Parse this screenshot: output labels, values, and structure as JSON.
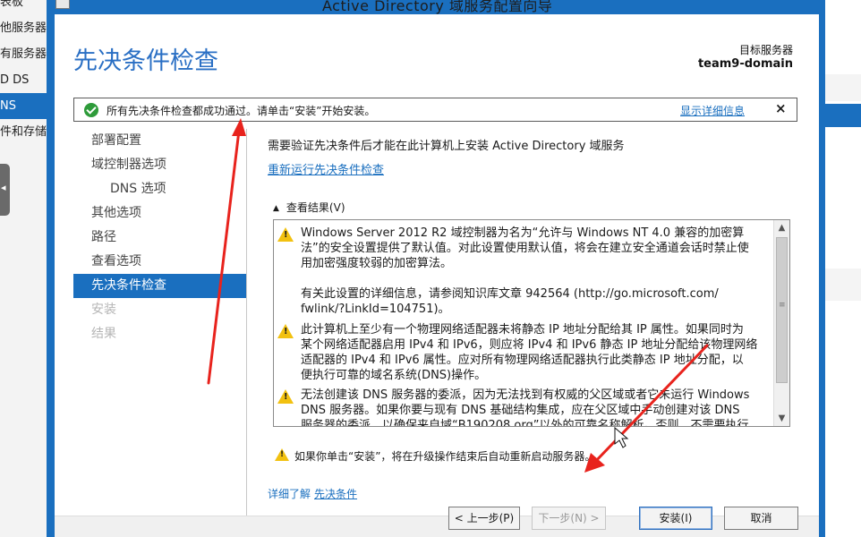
{
  "window": {
    "title": "Active Directory 域服务配置向导"
  },
  "background": {
    "left_items": [
      {
        "label": "表板",
        "selected": false
      },
      {
        "label": "他服务器",
        "selected": false
      },
      {
        "label": "有服务器",
        "selected": false
      },
      {
        "label": "D DS",
        "selected": false
      },
      {
        "label": "NS",
        "selected": true
      },
      {
        "label": "件和存储",
        "selected": false
      }
    ]
  },
  "header": {
    "page_title": "先决条件检查",
    "target_label": "目标服务器",
    "target_value": "team9-domain"
  },
  "status_bar": {
    "icon": "check-circle-icon",
    "text": "所有先决条件检查都成功通过。请单击“安装”开始安装。",
    "details_link": "显示详细信息",
    "close_glyph": "×"
  },
  "nav": {
    "items": [
      {
        "label": "部署配置",
        "state": "normal",
        "indent": false
      },
      {
        "label": "域控制器选项",
        "state": "normal",
        "indent": false
      },
      {
        "label": "DNS 选项",
        "state": "normal",
        "indent": true
      },
      {
        "label": "其他选项",
        "state": "normal",
        "indent": false
      },
      {
        "label": "路径",
        "state": "normal",
        "indent": false
      },
      {
        "label": "查看选项",
        "state": "normal",
        "indent": false
      },
      {
        "label": "先决条件检查",
        "state": "active",
        "indent": false
      },
      {
        "label": "安装",
        "state": "disabled",
        "indent": false
      },
      {
        "label": "结果",
        "state": "disabled",
        "indent": false
      }
    ]
  },
  "main": {
    "intro_text": "需要验证先决条件后才能在此计算机上安装 Active Directory 域服务",
    "rerun_link": "重新运行先决条件检查",
    "results_toggle": "查看结果(V)",
    "results": [
      {
        "icon": "warning-icon",
        "text": "Windows Server 2012 R2 域控制器为名为“允许与 Windows NT 4.0 兼容的加密算\n法”的安全设置提供了默认值。对此设置使用默认值，将会在建立安全通道会话时禁止使\n用加密强度较弱的加密算法。\n\n有关此设置的详细信息，请参阅知识库文章 942564 (http://go.microsoft.com/\nfwlink/?LinkId=104751)。"
      },
      {
        "icon": "warning-icon",
        "text": "此计算机上至少有一个物理网络适配器未将静态 IP 地址分配给其 IP 属性。如果同时为\n某个网络适配器启用 IPv4 和 IPv6，则应将 IPv4 和 IPv6 静态 IP 地址分配给该物理网络\n适配器的 IPv4 和 IPv6 属性。应对所有物理网络适配器执行此类静态 IP 地址分配，以\n便执行可靠的域名系统(DNS)操作。"
      },
      {
        "icon": "warning-icon",
        "text": "无法创建该 DNS 服务器的委派，因为无法找到有权威的父区域或者它未运行 Windows\nDNS 服务器。如果你要与现有 DNS 基础结构集成，应在父区域中手动创建对该 DNS\n服务器的委派，以确保来自域“B190208.org”以外的可靠名称解析。否则，不需要执行"
      }
    ],
    "restart_warning": "如果你单击“安装”，将在升级操作结束后自动重新启动服务器。",
    "learn_more_prefix": "详细了解",
    "learn_more_link": "先决条件"
  },
  "buttons": {
    "back": "< 上一步(P)",
    "next": "下一步(N) >",
    "install": "安装(I)",
    "cancel": "取消"
  },
  "colors": {
    "accent": "#1a6fbf",
    "title_blue": "#2a6fc4",
    "success": "#2e9b3a",
    "warning": "#f2c110",
    "annotation": "#e8231d"
  }
}
